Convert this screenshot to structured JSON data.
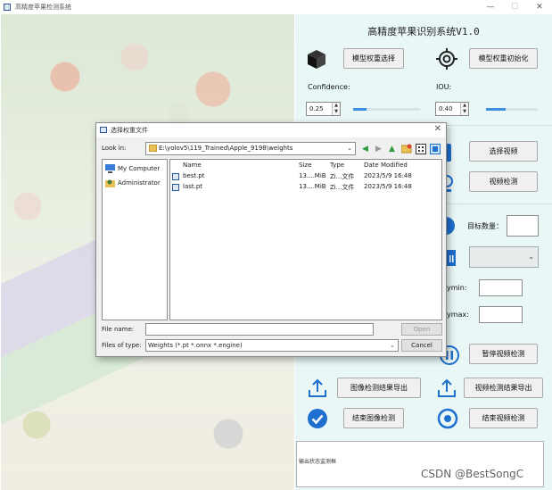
{
  "window": {
    "title": "高精度苹果检测系统",
    "controls": {
      "minimize": "—",
      "maximize": "☐",
      "close": "✕"
    }
  },
  "app": {
    "title": "高精度苹果识别系统V1.0",
    "buttons": {
      "model_select": "模型权重选择",
      "model_init": "模型权重初始化",
      "select_video": "选择视频",
      "video_detect": "视频检测",
      "pause_video": "暂停视频检测",
      "export_image": "图像检测结果导出",
      "export_video": "视频检测结果导出",
      "stop_image": "结束图像检测",
      "stop_video": "结束视频检测"
    },
    "confidence": {
      "label": "Confidence:",
      "value": "0.25",
      "level": 0.25
    },
    "iou": {
      "label": "IOU:",
      "value": "0.40",
      "level": 0.4
    },
    "target_count_label": "目标数量：",
    "ymin_label": "ymin:",
    "ymax_label": "ymax:",
    "output_placeholder": "输出状态监测框",
    "colors": {
      "accent": "#3b8fe0",
      "panel": "#eaf7f7"
    }
  },
  "dialog": {
    "title": "选择权重文件",
    "look_in_label": "Look in:",
    "look_in_path": "E:\\yolov5\\119_Trained\\Apple_9198\\weights",
    "toolbar_icons": [
      "back-icon",
      "forward-icon",
      "up-icon",
      "new-folder-icon",
      "list-view-icon",
      "detail-view-icon"
    ],
    "sidebar": [
      {
        "label": "My Computer",
        "icon": "computer-icon"
      },
      {
        "label": "Administrator",
        "icon": "user-folder-icon"
      }
    ],
    "columns": {
      "name": "Name",
      "size": "Size",
      "type": "Type",
      "date": "Date Modified"
    },
    "files": [
      {
        "name": "best.pt",
        "size": "13....MiB",
        "type": "Zi...文件",
        "date": "2023/5/9 16:48"
      },
      {
        "name": "last.pt",
        "size": "13....MiB",
        "type": "Zi...文件",
        "date": "2023/5/9 16:48"
      }
    ],
    "file_name_label": "File name:",
    "file_name_value": "",
    "files_of_type_label": "Files of type:",
    "files_of_type_value": "Weights (*.pt *.onnx *.engine)",
    "open_label": "Open",
    "cancel_label": "Cancel"
  },
  "watermark": "CSDN @BestSongC"
}
